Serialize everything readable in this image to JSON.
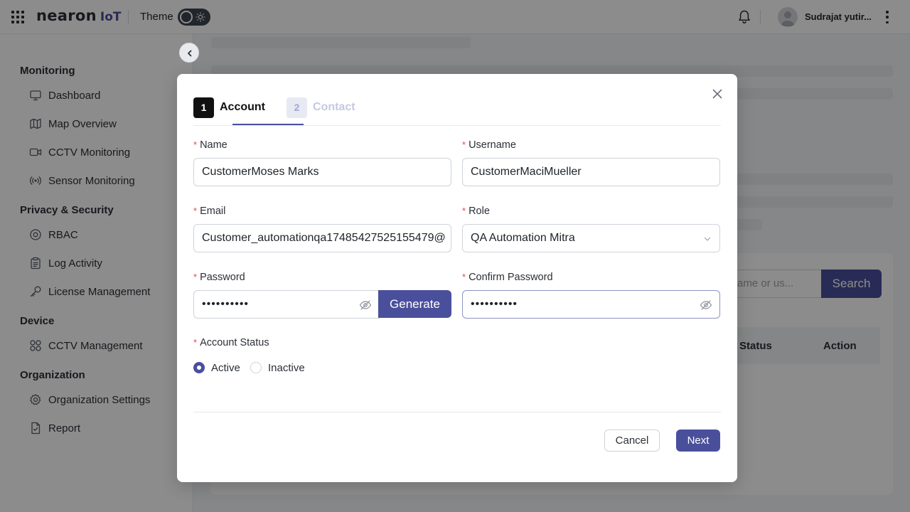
{
  "header": {
    "logo_main": "nearon",
    "logo_suffix": "IoT",
    "theme_label": "Theme",
    "user_name": "Sudrajat yutir..."
  },
  "sidebar": {
    "groups": [
      {
        "title": "Monitoring",
        "items": [
          {
            "label": "Dashboard",
            "icon": "monitor-icon"
          },
          {
            "label": "Map Overview",
            "icon": "map-icon"
          },
          {
            "label": "CCTV Monitoring",
            "icon": "video-camera-icon"
          },
          {
            "label": "Sensor Monitoring",
            "icon": "broadcast-icon"
          }
        ]
      },
      {
        "title": "Privacy & Security",
        "items": [
          {
            "label": "RBAC",
            "icon": "at-sign-icon"
          },
          {
            "label": "Log Activity",
            "icon": "clipboard-icon"
          },
          {
            "label": "License Management",
            "icon": "key-icon"
          }
        ]
      },
      {
        "title": "Device",
        "items": [
          {
            "label": "CCTV Management",
            "icon": "grid-circles-icon"
          }
        ]
      },
      {
        "title": "Organization",
        "items": [
          {
            "label": "Organization Settings",
            "icon": "gear-icon"
          },
          {
            "label": "Report",
            "icon": "file-check-icon"
          }
        ]
      }
    ]
  },
  "background": {
    "search_placeholder": "ame or us...",
    "search_button": "Search",
    "columns": [
      "Status",
      "Action"
    ]
  },
  "modal": {
    "steps": [
      {
        "number": "1",
        "label": "Account",
        "active": true
      },
      {
        "number": "2",
        "label": "Contact",
        "active": false
      }
    ],
    "fields": {
      "name": {
        "label": "Name",
        "value": "CustomerMoses Marks"
      },
      "username": {
        "label": "Username",
        "value": "CustomerMaciMueller"
      },
      "email": {
        "label": "Email",
        "value": "Customer_automationqa17485427525155479@"
      },
      "role": {
        "label": "Role",
        "value": "QA Automation Mitra"
      },
      "password": {
        "label": "Password",
        "value": "••••••••••"
      },
      "confirm_password": {
        "label": "Confirm Password",
        "value": "••••••••••"
      },
      "account_status": {
        "label": "Account Status",
        "options": [
          "Active",
          "Inactive"
        ],
        "selected": "Active"
      }
    },
    "generate_button": "Generate",
    "cancel_button": "Cancel",
    "next_button": "Next"
  },
  "colors": {
    "primary": "#4a4f9c",
    "required": "#e5484d",
    "overlay": "rgba(0,0,0,0.45)"
  }
}
